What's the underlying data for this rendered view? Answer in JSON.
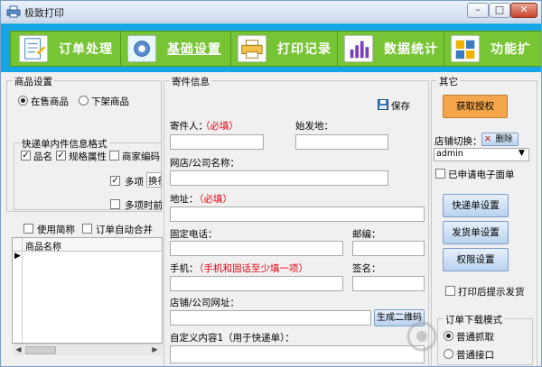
{
  "window": {
    "title": "极致打印"
  },
  "titlebar_controls": {
    "minimize": "–",
    "maximize": "□",
    "close": "✕"
  },
  "toolbar": {
    "items": [
      {
        "label": "订单处理",
        "icon": "order-icon"
      },
      {
        "label": "基础设置",
        "icon": "gear-icon",
        "active": true
      },
      {
        "label": "打印记录",
        "icon": "print-record-icon"
      },
      {
        "label": "数据统计",
        "icon": "stats-chart-icon"
      },
      {
        "label": "功能扩",
        "icon": "extension-icon"
      }
    ]
  },
  "product_settings": {
    "title": "商品设置",
    "radio_on_sale": "在售商品",
    "radio_off_sale": "下架商品",
    "format_title": "快递单内件信息格式",
    "chk_name": "品名",
    "chk_spec": "规格属性",
    "chk_code": "商家编码",
    "chk_multi": "多项",
    "multi_value": "换行",
    "chk_multi_time": "多项时前",
    "chk_short_name": "使用简称",
    "chk_auto_merge": "订单自动合并",
    "grid_header": "商品名称"
  },
  "sender": {
    "title": "寄件信息",
    "save": "保存",
    "name_label": "寄件人：",
    "required": "（必填）",
    "origin_label": "始发地：",
    "shop_label": "网店/公司名称：",
    "address_label": "地址：",
    "phone_label": "固定电话：",
    "zip_label": "邮编：",
    "mobile_label": "手机：",
    "mobile_hint": "（手机和固话至少填一项）",
    "sign_label": "签名：",
    "url_label": "店铺/公司网址：",
    "qr_button": "生成二维码",
    "custom_label": "自定义内容1（用于快递单）："
  },
  "other": {
    "title": "其它",
    "auth_button": "获取授权",
    "shop_switch_label": "店铺切换：",
    "delete_button": "删除",
    "shop_value": "admin",
    "chk_esheet": "已申请电子面单",
    "btn_express": "快递单设置",
    "btn_ship": "发货单设置",
    "btn_perm": "权限设置",
    "chk_print_prompt": "打印后提示发货",
    "download_title": "订单下载模式",
    "radio_normal_fetch": "普通抓取",
    "radio_normal_api": "普通接口"
  },
  "colors": {
    "toolbar_bg": "#16a6e6",
    "toolbar_inner": "#77c434",
    "auth_button": "#f3a64c",
    "required": "#e60012"
  }
}
